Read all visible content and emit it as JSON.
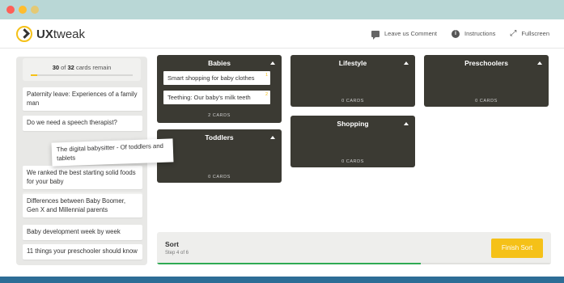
{
  "header": {
    "logo_text_bold": "UX",
    "logo_text": "tweak",
    "actions": [
      {
        "icon": "comment-icon",
        "label": "Leave us Comment"
      },
      {
        "icon": "info-icon",
        "label": "Instructions"
      },
      {
        "icon": "fullscreen-icon",
        "label": "Fullscreen"
      }
    ]
  },
  "progress": {
    "remaining": "30",
    "of": "of",
    "total": "32",
    "suffix": "cards remain",
    "fraction": 0.0625
  },
  "cards": [
    "Paternity leave: Experiences of a family man",
    "Do we need a speech therapist?",
    "We ranked the best starting solid foods for your baby",
    "Differences between Baby Boomer, Gen X and Millennial parents",
    "Baby development week by week",
    "11 things your preschooler should know"
  ],
  "dragging_card": "The digital babysitter - Of toddlers and tablets",
  "categories": {
    "babies": {
      "title": "Babies",
      "cards": [
        {
          "label": "Smart shopping for baby clothes",
          "num": "1"
        },
        {
          "label": "Teething: Our baby's milk teeth",
          "num": "2"
        }
      ],
      "count": "2 CARDS"
    },
    "lifestyle": {
      "title": "Lifestyle",
      "count": "0 CARDS"
    },
    "preschoolers": {
      "title": "Preschoolers",
      "count": "0 CARDS"
    },
    "toddlers": {
      "title": "Toddlers",
      "count": "0 CARDS"
    },
    "shopping": {
      "title": "Shopping",
      "count": "0 CARDS"
    }
  },
  "footer": {
    "title": "Sort",
    "step": "Step 4 of 6",
    "finish_label": "Finish Sort",
    "progress_fraction": 0.67
  },
  "colors": {
    "accent": "#f5c118",
    "category_bg": "#3b3a33",
    "success": "#2faa53"
  }
}
